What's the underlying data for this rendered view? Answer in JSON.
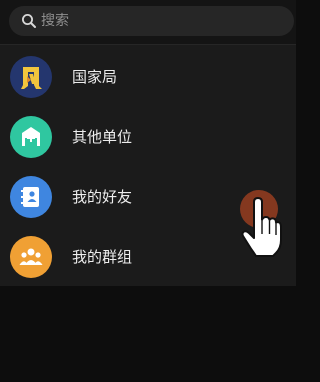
{
  "search": {
    "placeholder": "搜索"
  },
  "list": {
    "items": [
      {
        "label": "国家局",
        "avatar_color": "#24366e",
        "icon": "national-bureau-emblem-icon"
      },
      {
        "label": "其他单位",
        "avatar_color": "#2fc7a0",
        "icon": "building-plus-icon"
      },
      {
        "label": "我的好友",
        "avatar_color": "#3f86e0",
        "icon": "contact-book-icon"
      },
      {
        "label": "我的群组",
        "avatar_color": "#f0a034",
        "icon": "group-people-icon"
      }
    ]
  },
  "cursor": {
    "color": "#8a3a20",
    "icon": "hand-pointer-icon"
  }
}
